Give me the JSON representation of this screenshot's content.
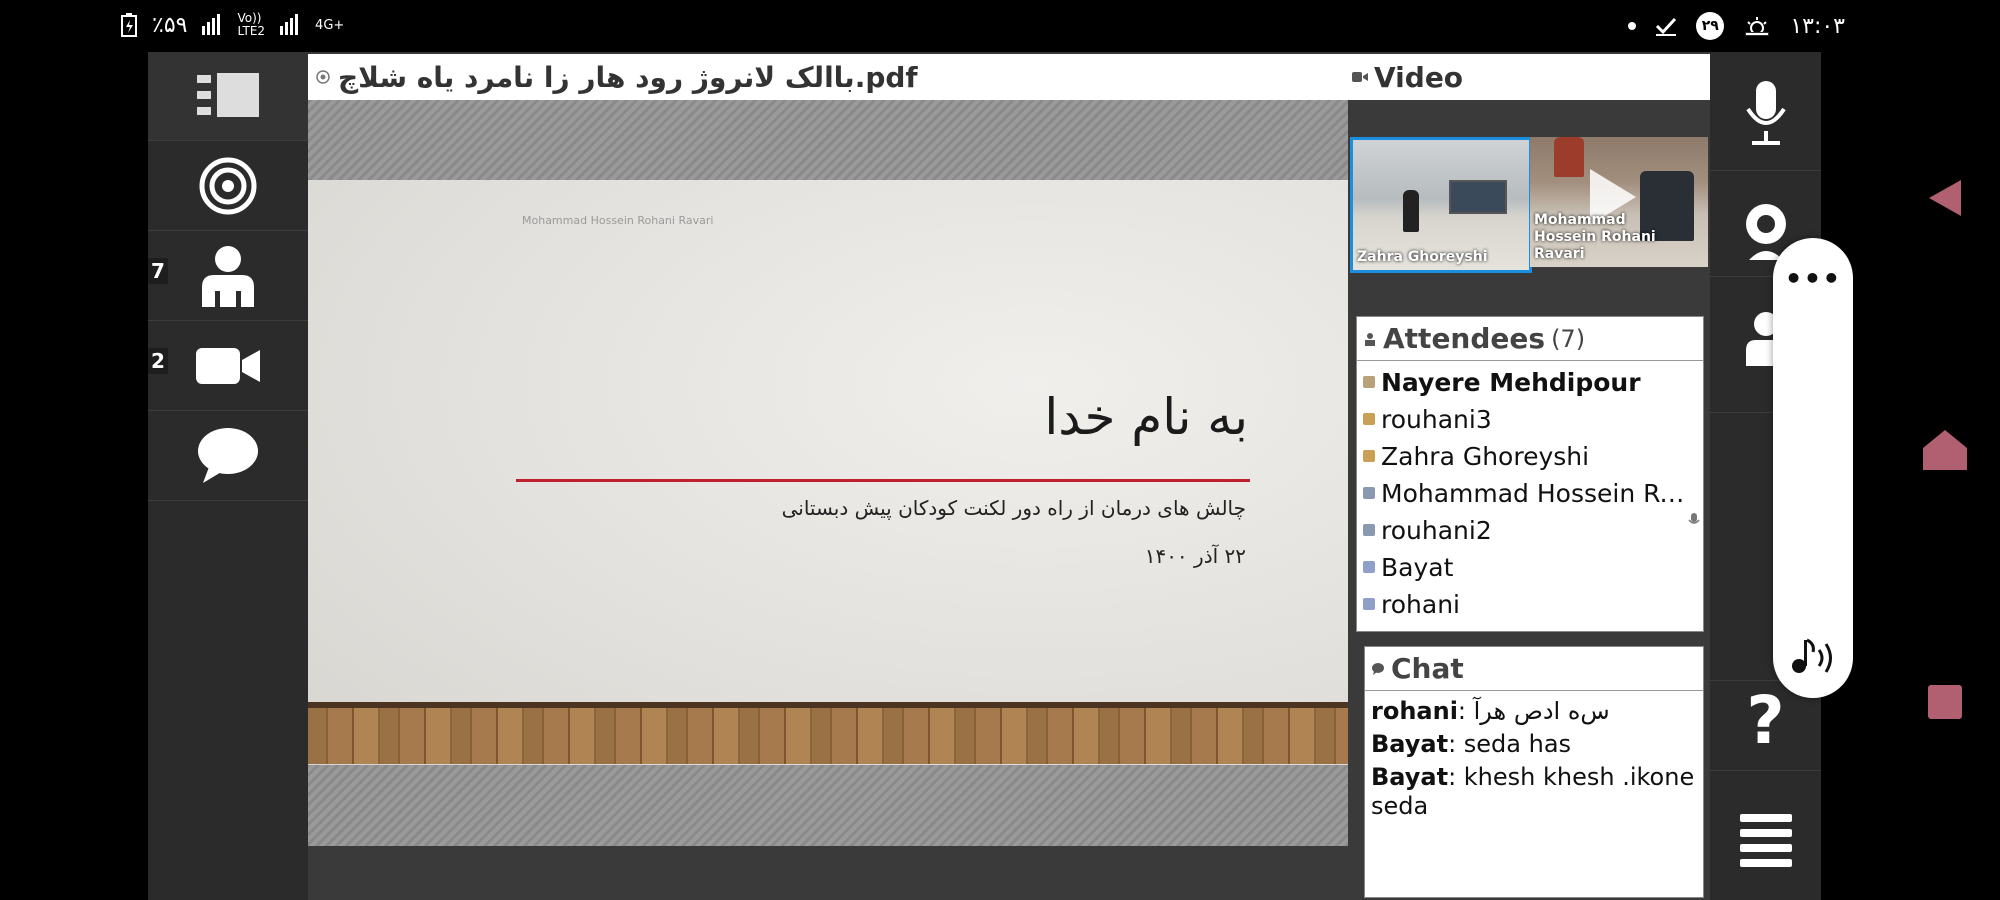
{
  "status_bar": {
    "battery": "٪۵۹",
    "network_volte": "Vo))",
    "network_lte": "LTE2",
    "network_4g": "4G+",
    "notification_count": "۲۹",
    "time": "۱۳:۰۳"
  },
  "left_rail": {
    "items": [
      {
        "icon": "layout-icon",
        "count": ""
      },
      {
        "icon": "target-icon",
        "count": ""
      },
      {
        "icon": "attendees-icon",
        "count": "7"
      },
      {
        "icon": "camera-icon",
        "count": "2"
      },
      {
        "icon": "chat-bubble-icon",
        "count": ""
      }
    ]
  },
  "document": {
    "filename": "باالک لانروژ رود هار زا نامرد یاه شلاچ.pdf",
    "slide": {
      "author": "Mohammad Hossein Rohani Ravari",
      "title": "به نام خدا",
      "subtitle": "چالش های درمان از راه دور لکنت کودکان پیش دبستانی",
      "date": "۲۲ آذر ۱۴۰۰"
    }
  },
  "video": {
    "heading": "Video",
    "tiles": [
      {
        "label": "Zahra Ghoreyshi",
        "active": true
      },
      {
        "label": "Mohammad Hossein Rohani Ravari",
        "active": false
      }
    ]
  },
  "attendees": {
    "heading": "Attendees",
    "count": "(7)",
    "list": [
      {
        "name": "Nayere Mehdipour",
        "bold": true
      },
      {
        "name": "rouhani3",
        "bold": false
      },
      {
        "name": "Zahra Ghoreyshi",
        "bold": false
      },
      {
        "name": "Mohammad Hossein Roh.",
        "bold": false
      },
      {
        "name": "rouhani2",
        "bold": false
      },
      {
        "name": "Bayat",
        "bold": false
      },
      {
        "name": "rohani",
        "bold": false
      }
    ]
  },
  "chat": {
    "heading": "Chat",
    "messages": [
      {
        "sender": "rohani",
        "text": ": س‌ه ادص هرآ"
      },
      {
        "sender": "Bayat",
        "text": ": seda has"
      },
      {
        "sender": "Bayat",
        "text": ": khesh khesh .ikone seda"
      }
    ]
  },
  "right_rail": {
    "items": [
      "microphone-icon",
      "webcam-icon",
      "person-icon",
      "help-icon",
      "menu-icon"
    ],
    "help_label": "?"
  },
  "floating_pill": {
    "top_label": "•••",
    "bottom_icon": "audio-icon"
  },
  "android_nav": [
    "back-icon",
    "home-icon",
    "recents-icon"
  ],
  "colors": {
    "accent_blue": "#1a8fe0",
    "slide_rule_red": "#c0202e",
    "rail_bg": "#2b2b2b"
  }
}
